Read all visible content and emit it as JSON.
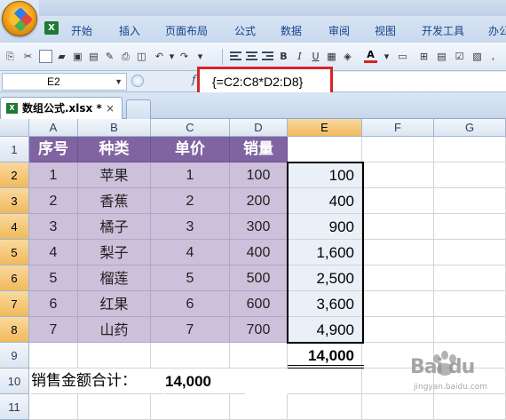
{
  "ribbon": {
    "tabs": [
      "开始",
      "插入",
      "页面布局",
      "公式",
      "数据",
      "审阅",
      "视图",
      "开发工具",
      "办公"
    ]
  },
  "formula_bar": {
    "name_box": "E2",
    "formula": "{=C2:C8*D2:D8}"
  },
  "workbook": {
    "tab_label": "数组公式.xlsx *",
    "close_glyph": "×"
  },
  "sheet": {
    "columns": [
      "A",
      "B",
      "C",
      "D",
      "E",
      "F",
      "G"
    ],
    "rows": [
      "1",
      "2",
      "3",
      "4",
      "5",
      "6",
      "7",
      "8",
      "9",
      "10",
      "11"
    ],
    "headers": [
      "序号",
      "种类",
      "单价",
      "销量"
    ],
    "data": [
      [
        "1",
        "苹果",
        "1",
        "100",
        "100"
      ],
      [
        "2",
        "香蕉",
        "2",
        "200",
        "400"
      ],
      [
        "3",
        "橘子",
        "3",
        "300",
        "900"
      ],
      [
        "4",
        "梨子",
        "4",
        "400",
        "1,600"
      ],
      [
        "5",
        "榴莲",
        "5",
        "500",
        "2,500"
      ],
      [
        "6",
        "红果",
        "6",
        "600",
        "3,600"
      ],
      [
        "7",
        "山药",
        "7",
        "700",
        "4,900"
      ]
    ],
    "total_e9": "14,000",
    "note_label": "销售金额合计：",
    "note_value": "14,000"
  },
  "watermark": {
    "brand": "Bai du",
    "sub": "jingyan.baidu.com"
  },
  "colors": {
    "header_purple": "#8064a2",
    "body_lavender": "#ccc0da",
    "highlight_red": "#d8232a"
  }
}
